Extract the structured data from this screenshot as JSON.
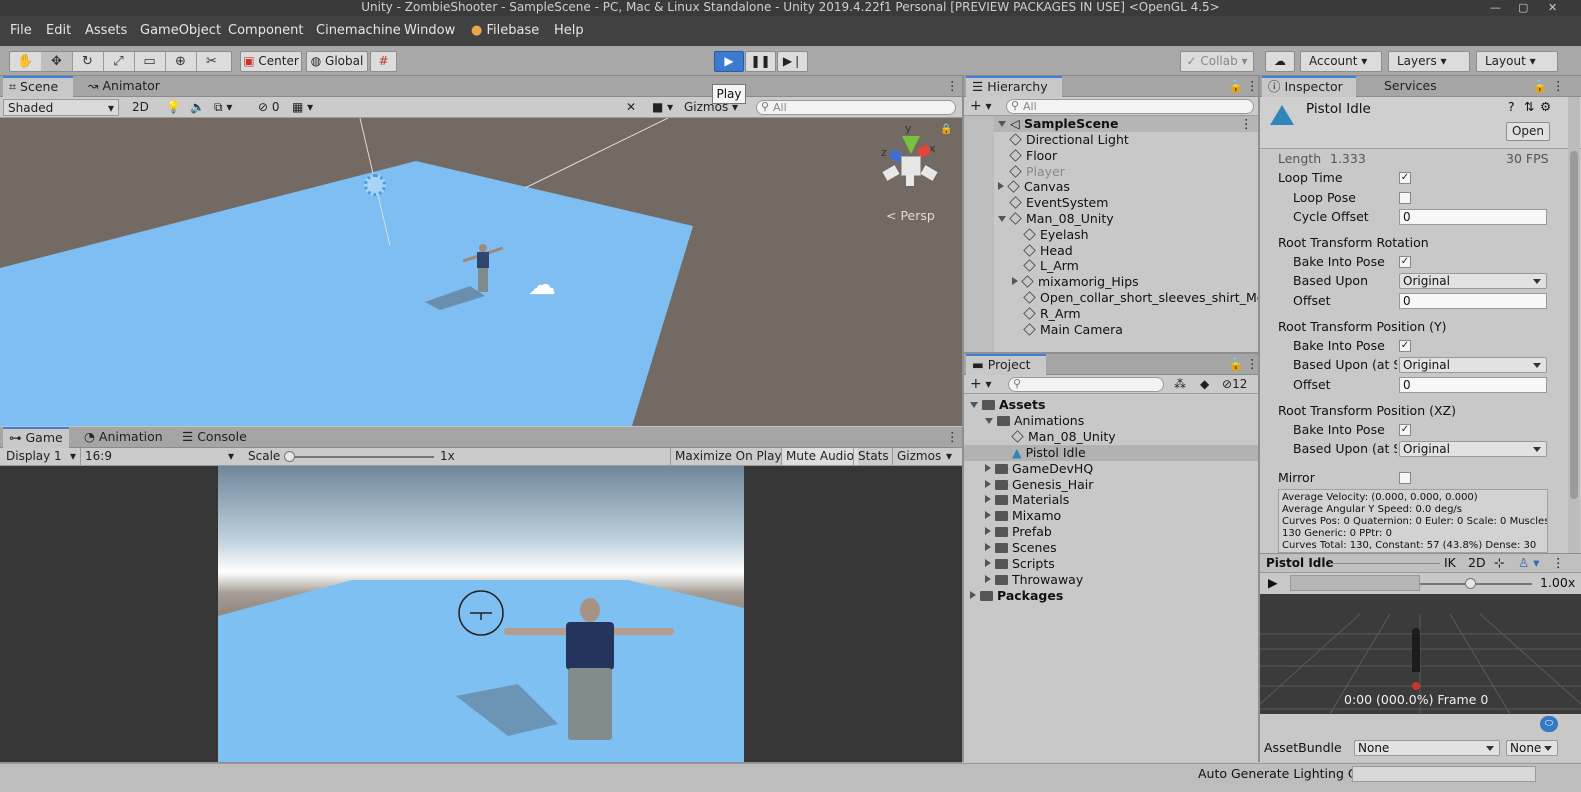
{
  "window": {
    "title": "Unity - ZombieShooter - SampleScene - PC, Mac & Linux Standalone - Unity 2019.4.22f1 Personal [PREVIEW PACKAGES IN USE] <OpenGL 4.5>"
  },
  "menu": [
    "File",
    "Edit",
    "Assets",
    "GameObject",
    "Component",
    "Cinemachine",
    "Window",
    "Filebase",
    "Help"
  ],
  "toolbar": {
    "pivot": "Center",
    "space": "Global",
    "tooltip": "Play",
    "collab": "Collab",
    "account": "Account",
    "layers": "Layers",
    "layout": "Layout"
  },
  "scene": {
    "tabs": [
      "Scene",
      "Animator"
    ],
    "shading": "Shaded",
    "mode2d": "2D",
    "hidden_count": "0",
    "gizmos": "Gizmos",
    "search_placeholder": "All",
    "persp": "Persp",
    "axes": {
      "x": "x",
      "y": "y",
      "z": "z"
    }
  },
  "game": {
    "tabs": [
      "Game",
      "Animation",
      "Console"
    ],
    "display": "Display 1",
    "aspect": "16:9",
    "scale_label": "Scale",
    "scale_value": "1x",
    "buttons": [
      "Maximize On Play",
      "Mute Audio",
      "Stats",
      "Gizmos"
    ]
  },
  "hierarchy": {
    "title": "Hierarchy",
    "search_placeholder": "All",
    "scene_name": "SampleScene",
    "items": [
      {
        "label": "Directional Light",
        "indent": 1,
        "arrow": ""
      },
      {
        "label": "Floor",
        "indent": 1,
        "arrow": ""
      },
      {
        "label": "Player",
        "indent": 1,
        "arrow": "",
        "disabled": true
      },
      {
        "label": "Canvas",
        "indent": 1,
        "arrow": "r"
      },
      {
        "label": "EventSystem",
        "indent": 1,
        "arrow": ""
      },
      {
        "label": "Man_08_Unity",
        "indent": 1,
        "arrow": "d"
      },
      {
        "label": "Eyelash",
        "indent": 2,
        "arrow": ""
      },
      {
        "label": "Head",
        "indent": 2,
        "arrow": ""
      },
      {
        "label": "L_Arm",
        "indent": 2,
        "arrow": ""
      },
      {
        "label": "mixamorig_Hips",
        "indent": 2,
        "arrow": "r"
      },
      {
        "label": "Open_collar_short_sleeves_shirt_Mer",
        "indent": 2,
        "arrow": ""
      },
      {
        "label": "R_Arm",
        "indent": 2,
        "arrow": ""
      },
      {
        "label": "Main Camera",
        "indent": 2,
        "arrow": ""
      }
    ]
  },
  "project": {
    "title": "Project",
    "hidden_count": "12",
    "items": [
      {
        "label": "Assets",
        "indent": 0,
        "arrow": "d",
        "bold": true
      },
      {
        "label": "Animations",
        "indent": 1,
        "arrow": "d"
      },
      {
        "label": "Man_08_Unity",
        "indent": 2,
        "arrow": "",
        "type": "model"
      },
      {
        "label": "Pistol Idle",
        "indent": 2,
        "arrow": "",
        "type": "clip",
        "selected": true
      },
      {
        "label": "GameDevHQ",
        "indent": 1,
        "arrow": "r"
      },
      {
        "label": "Genesis_Hair",
        "indent": 1,
        "arrow": "r"
      },
      {
        "label": "Materials",
        "indent": 1,
        "arrow": "r"
      },
      {
        "label": "Mixamo",
        "indent": 1,
        "arrow": "r"
      },
      {
        "label": "Prefab",
        "indent": 1,
        "arrow": "r"
      },
      {
        "label": "Scenes",
        "indent": 1,
        "arrow": "r"
      },
      {
        "label": "Scripts",
        "indent": 1,
        "arrow": "r"
      },
      {
        "label": "Throwaway",
        "indent": 1,
        "arrow": "r"
      },
      {
        "label": "Packages",
        "indent": 0,
        "arrow": "r",
        "bold": true
      }
    ]
  },
  "inspector": {
    "tabs": [
      "Inspector",
      "Services"
    ],
    "asset_name": "Pistol Idle",
    "open_label": "Open",
    "length_label": "Length",
    "length_value": "1.333",
    "fps": "30 FPS",
    "loop_time": "Loop Time",
    "loop_pose": "Loop Pose",
    "cycle_offset": "Cycle Offset",
    "cycle_offset_value": "0",
    "rot_header": "Root Transform Rotation",
    "bake_into_pose": "Bake Into Pose",
    "based_upon": "Based Upon",
    "based_upon_start": "Based Upon (at Sta",
    "original": "Original",
    "offset": "Offset",
    "offset_value": "0",
    "posy_header": "Root Transform Position (Y)",
    "posxz_header": "Root Transform Position (XZ)",
    "mirror": "Mirror",
    "info_lines": [
      "Average Velocity: (0.000, 0.000, 0.000)",
      "Average Angular Y Speed: 0.0 deg/s",
      "Curves Pos: 0 Quaternion: 0 Euler: 0 Scale: 0 Muscles:",
      "130 Generic: 0 PPtr: 0",
      "Curves Total: 130, Constant: 57 (43.8%) Dense: 30"
    ],
    "preview_title": "Pistol Idle",
    "preview_ik": "IK",
    "preview_2d": "2D",
    "preview_speed": "1.00x",
    "preview_status": "0:00 (000.0%) Frame 0",
    "assetbundle_label": "AssetBundle",
    "assetbundle_value": "None",
    "assetbundle_variant": "None"
  },
  "status": {
    "text": "Auto Generate Lighting Off"
  }
}
